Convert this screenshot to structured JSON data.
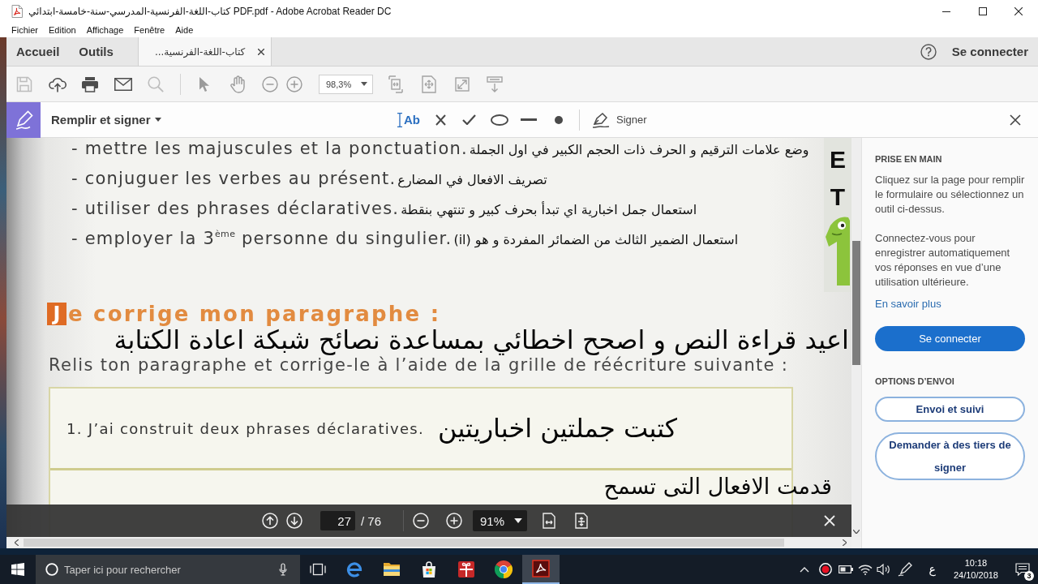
{
  "window": {
    "title": "كتاب-اللغة-الفرنسية-المدرسي-سنة-خامسة-ابتدائي PDF.pdf - Adobe Acrobat Reader DC"
  },
  "menu": [
    "Fichier",
    "Edition",
    "Affichage",
    "Fenêtre",
    "Aide"
  ],
  "tabs": [
    {
      "kind": "page",
      "label": "Accueil",
      "selected": false
    },
    {
      "kind": "page",
      "label": "Outils",
      "selected": false
    },
    {
      "kind": "document",
      "label": "كتاب-اللغة-الفرنسية...",
      "selected": true
    }
  ],
  "account": {
    "label": "Se connecter"
  },
  "toolbar": {
    "buttons": [
      {
        "disabled": true
      },
      {
        "disabled": false
      },
      {
        "disabled": false
      },
      {
        "disabled": false
      },
      {
        "disabled": true
      }
    ],
    "zoom": "98,3%"
  },
  "fill_sign": {
    "title": "Remplir et signer",
    "text_tool": "Ab",
    "sign_label": "Signer"
  },
  "document": {
    "lines": [
      {
        "text": "- mettre les majuscules et la ponctuation.",
        "note": "وضع علامات الترقيم و الحرف ذات الحجم الكبير في اول الجملة"
      },
      {
        "text": "- conjuguer les verbes au présent.",
        "note": "تصريف الافعال في المضارع"
      },
      {
        "text": "- utiliser des phrases déclaratives.",
        "note": "استعمال جمل اخبارية اي تبدأ بحرف كبير و تنتهي بنقطة"
      },
      {
        "text": "- employer la 3$^{ème}$ personne du singulier.",
        "note": "استعمال الضمير الثالث من الضمائر المفردة و هو (il)"
      }
    ],
    "margin_letters": [
      "E",
      "T"
    ],
    "heading": {
      "initial": "J",
      "text": "e corrige mon paragraphe :"
    },
    "heading_note": "اعيد قراءة النص و اصحح اخطائي بمساعدة نصائح شبكة اعادة الكتابة",
    "instruction": "Relis ton paragraphe et corrige-le à l’aide de la grille de réécriture suivante :",
    "grid_rows": [
      {
        "text": "1. J’ai construit deux phrases déclaratives.",
        "note": "كتبت جملتين اخباريتين"
      }
    ],
    "grid_note": "قدمت الافعال التى تسمح"
  },
  "page_nav": {
    "page": "27",
    "total": "/ 76",
    "zoom": "91%"
  },
  "panel": {
    "heading": "PRISE EN MAIN",
    "paragraphs": [
      "Cliquez sur la page pour remplir le formulaire ou sélectionnez un outil ci-dessus.",
      "Connectez-vous pour enregistrer automatiquement vos réponses en vue d’une utilisation ultérieure."
    ],
    "link": "En savoir plus",
    "primary_button": "Se connecter",
    "send_heading": "OPTIONS D’ENVOI",
    "send_buttons": [
      "Envoi et suivi",
      "Demander à des tiers de signer"
    ]
  },
  "taskbar": {
    "search": {
      "placeholder": "Taper ici pour rechercher"
    },
    "apps": [
      {
        "selected": false
      },
      {
        "selected": false
      },
      {
        "selected": false
      },
      {
        "selected": false
      },
      {
        "selected": false
      },
      {
        "selected": true
      }
    ],
    "language": "ع",
    "time": "10:18",
    "date": "24/10/2018",
    "notifications": "3"
  }
}
